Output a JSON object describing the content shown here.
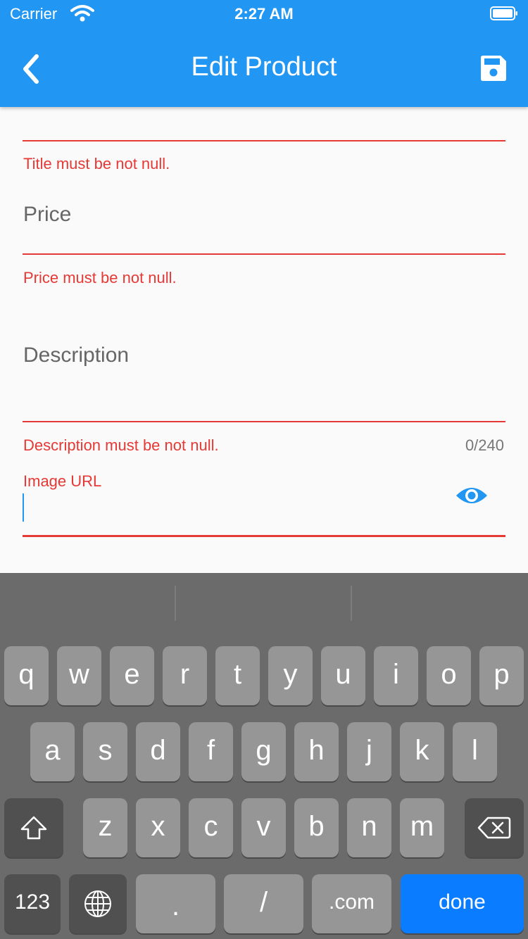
{
  "status": {
    "carrier": "Carrier",
    "time": "2:27 AM"
  },
  "appbar": {
    "title": "Edit Product"
  },
  "form": {
    "title_error": "Title must be not null.",
    "price_label": "Price",
    "price_error": "Price must be not null.",
    "description_label": "Description",
    "description_error": "Description must be not null.",
    "description_counter": "0/240",
    "image_url_label": "Image URL"
  },
  "keyboard": {
    "row1": [
      "q",
      "w",
      "e",
      "r",
      "t",
      "y",
      "u",
      "i",
      "o",
      "p"
    ],
    "row2": [
      "a",
      "s",
      "d",
      "f",
      "g",
      "h",
      "j",
      "k",
      "l"
    ],
    "row3": [
      "z",
      "x",
      "c",
      "v",
      "b",
      "n",
      "m"
    ],
    "num_key": "123",
    "dot_key": ".",
    "slash_key": "/",
    "com_key": ".com",
    "done_key": "done"
  },
  "icons": {
    "back": "chevron-left-icon",
    "save": "save-icon",
    "visibility": "eye-icon",
    "shift": "shift-icon",
    "backspace": "backspace-icon",
    "globe": "globe-icon"
  },
  "colors": {
    "primary": "#2196f3",
    "error": "#e53935",
    "done": "#0a7cff"
  }
}
